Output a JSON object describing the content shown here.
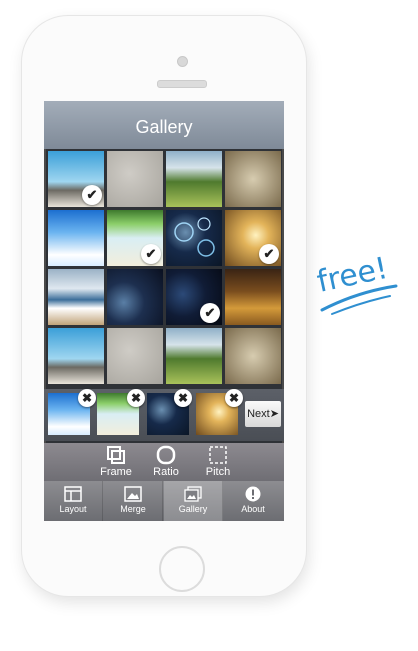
{
  "header": {
    "title": "Gallery"
  },
  "grid": {
    "tiles": [
      {
        "icon": "beach-rocks-photo",
        "checked": true
      },
      {
        "icon": "grey-texture-photo",
        "checked": false
      },
      {
        "icon": "green-landscape-photo",
        "checked": false
      },
      {
        "icon": "raindrops-photo",
        "checked": false
      },
      {
        "icon": "blue-sky-photo",
        "checked": false
      },
      {
        "icon": "palm-beach-photo",
        "checked": true
      },
      {
        "icon": "bubbles-photo",
        "checked": false
      },
      {
        "icon": "golden-bubble-photo",
        "checked": true
      },
      {
        "icon": "ocean-waves-photo",
        "checked": false
      },
      {
        "icon": "planet-space-photo",
        "checked": false
      },
      {
        "icon": "dark-planet-photo",
        "checked": true
      },
      {
        "icon": "autumn-leaves-photo",
        "checked": false
      },
      {
        "icon": "beach-rocks-photo",
        "checked": false
      },
      {
        "icon": "grey-texture-photo",
        "checked": false
      },
      {
        "icon": "green-landscape-photo",
        "checked": false
      },
      {
        "icon": "raindrops-photo",
        "checked": false
      }
    ],
    "check_glyph": "✔"
  },
  "tray": {
    "remove_glyph": "✖",
    "next_label": "Next",
    "next_arrow": "➤"
  },
  "tools": {
    "frame_label": "Frame",
    "ratio_label": "Ratio",
    "pitch_label": "Pitch"
  },
  "tabs": [
    {
      "label": "Layout",
      "icon": "layout-icon"
    },
    {
      "label": "Merge",
      "icon": "merge-photo-icon"
    },
    {
      "label": "Gallery",
      "icon": "gallery-icon",
      "active": true
    },
    {
      "label": "About",
      "icon": "info-icon"
    }
  ],
  "promo": {
    "free_text": "free!"
  },
  "colors": {
    "accent": "#2f8fd0",
    "title_bar": "#8d98a6"
  }
}
